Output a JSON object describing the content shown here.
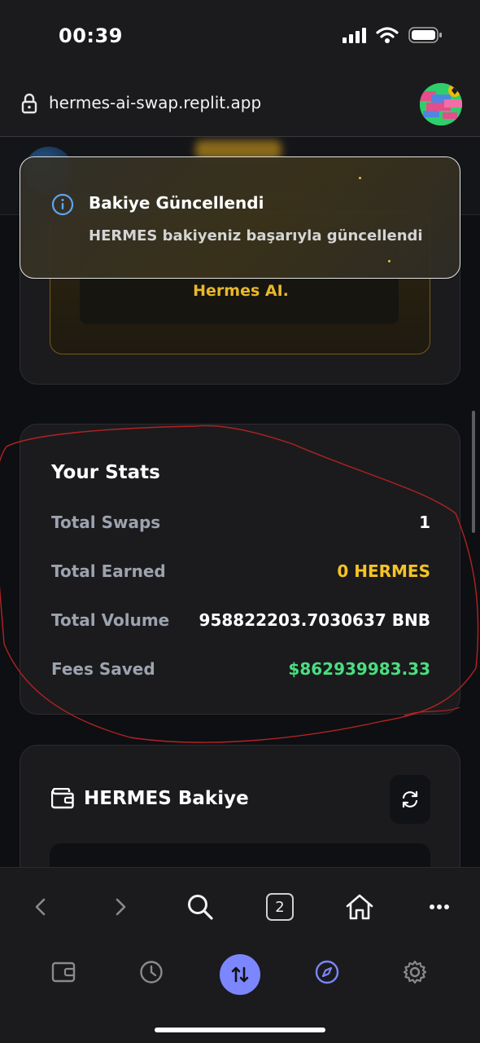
{
  "status_bar": {
    "time": "00:39"
  },
  "browser": {
    "url": "hermes-ai-swap.replit.app",
    "tab_count": "2"
  },
  "hermes_card": {
    "label": "Hermes AI."
  },
  "stats": {
    "title": "Your Stats",
    "rows": [
      {
        "label": "Total Swaps",
        "value": "1"
      },
      {
        "label": "Total Earned",
        "value": "0 HERMES"
      },
      {
        "label": "Total Volume",
        "value": "958822203.7030637 BNB"
      },
      {
        "label": "Fees Saved",
        "value": "$862939983.33"
      }
    ],
    "colors": {
      "earned": "#f7c325",
      "saved": "#4ade80",
      "label": "#9ca3af"
    }
  },
  "bakiye": {
    "title": "HERMES Bakiye"
  },
  "toast": {
    "title": "Bakiye Güncellendi",
    "message": "HERMES bakiyeniz başarıyla güncellendi"
  },
  "icons": {
    "status": [
      "signal-icon",
      "wifi-icon",
      "battery-icon"
    ],
    "nav": [
      "back-icon",
      "forward-icon",
      "search-icon",
      "tabs-icon",
      "home-icon",
      "more-icon"
    ],
    "app": [
      "wallet-icon",
      "history-icon",
      "swap-icon",
      "explore-icon",
      "settings-icon"
    ]
  },
  "accent": "#7c86ff"
}
